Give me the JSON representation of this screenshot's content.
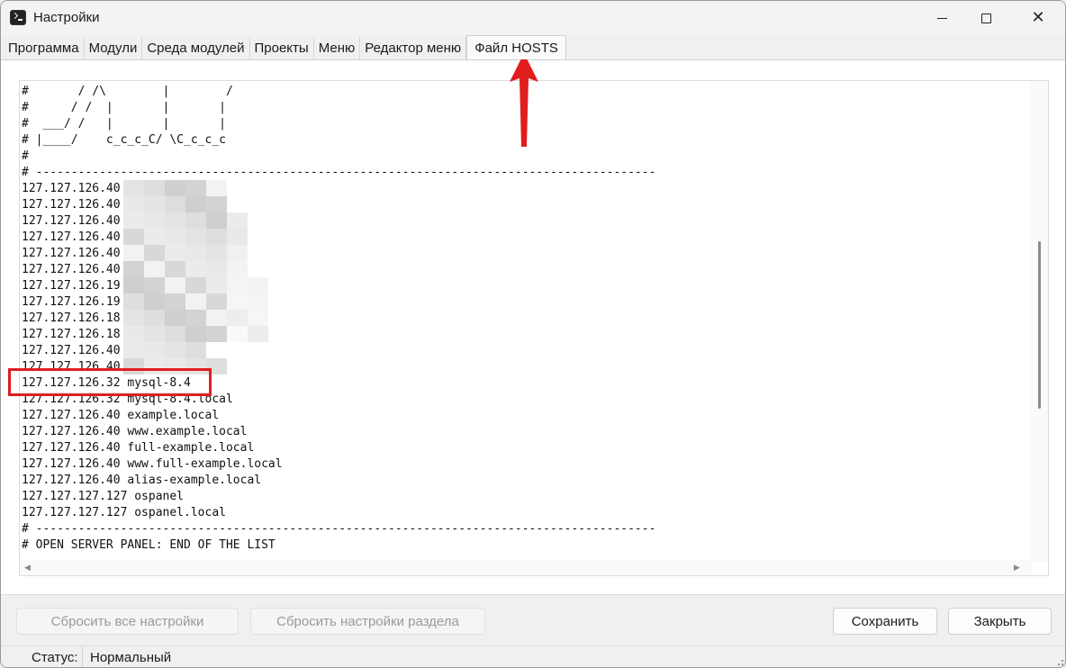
{
  "window": {
    "title": "Настройки",
    "minimize_icon": "minimize-icon",
    "maximize_icon": "maximize-icon",
    "close_icon": "close-icon"
  },
  "tabs": [
    {
      "label": "Программа",
      "active": false
    },
    {
      "label": "Модули",
      "active": false
    },
    {
      "label": "Среда модулей",
      "active": false
    },
    {
      "label": "Проекты",
      "active": false
    },
    {
      "label": "Меню",
      "active": false
    },
    {
      "label": "Редактор меню",
      "active": false
    },
    {
      "label": "Файл HOSTS",
      "active": true
    }
  ],
  "hosts_lines": [
    "#       / /\\        |        /",
    "#      / /  |       |       |",
    "#  ___/ /   |       |       |",
    "# |____/    c_c_c_C/ \\C_c_c_c",
    "#",
    "# ----------------------------------------------------------------------------------------",
    "127.127.126.40",
    "127.127.126.40",
    "127.127.126.40",
    "127.127.126.40",
    "127.127.126.40",
    "127.127.126.40",
    "127.127.126.19",
    "127.127.126.19",
    "127.127.126.18",
    "127.127.126.18",
    "127.127.126.40",
    "127.127.126.40",
    "127.127.126.32 mysql-8.4",
    "127.127.126.32 mysql-8.4.local",
    "127.127.126.40 example.local",
    "127.127.126.40 www.example.local",
    "127.127.126.40 full-example.local",
    "127.127.126.40 www.full-example.local",
    "127.127.126.40 alias-example.local",
    "127.127.127.127 ospanel",
    "127.127.127.127 ospanel.local",
    "# ----------------------------------------------------------------------------------------",
    "# OPEN SERVER PANEL: END OF THE LIST"
  ],
  "buttons": {
    "reset_all": "Сбросить все настройки",
    "reset_section": "Сбросить настройки раздела",
    "save": "Сохранить",
    "close": "Закрыть"
  },
  "status": {
    "label": "Статус:",
    "value": "Нормальный"
  },
  "colors": {
    "annotation_red": "#e01e1e",
    "background": "#f0f0f0",
    "editor_bg": "#ffffff"
  }
}
